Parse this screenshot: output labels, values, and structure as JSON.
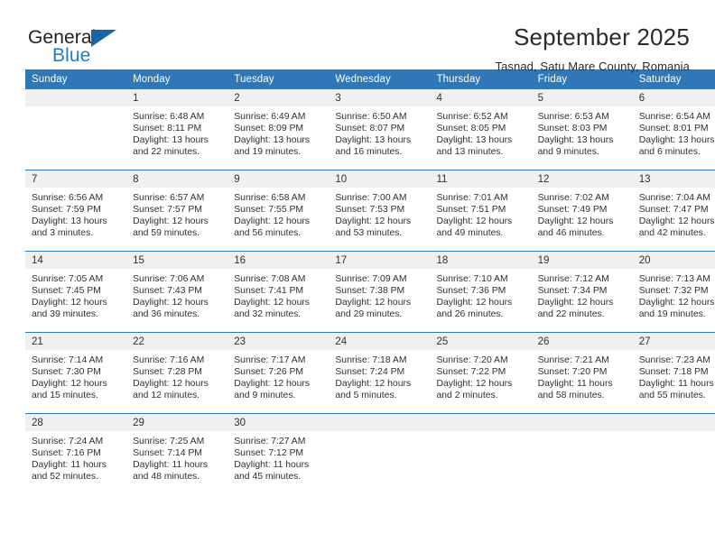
{
  "logo": {
    "word_top": "General",
    "word_bottom": "Blue",
    "triangle_color": "#1565a8",
    "blue_color": "#1f7cc4"
  },
  "header": {
    "title": "September 2025",
    "subtitle": "Tasnad, Satu Mare County, Romania"
  },
  "theme": {
    "header_blue": "#2f77b6",
    "daynum_gray": "#f0f0f0",
    "text": "#303030"
  },
  "calendar": {
    "weekday_headers": [
      "Sunday",
      "Monday",
      "Tuesday",
      "Wednesday",
      "Thursday",
      "Friday",
      "Saturday"
    ],
    "weeks": [
      [
        {
          "day": "",
          "sunrise": "",
          "sunset": "",
          "daylight_line1": "",
          "daylight_line2": ""
        },
        {
          "day": "1",
          "sunrise": "Sunrise: 6:48 AM",
          "sunset": "Sunset: 8:11 PM",
          "daylight_line1": "Daylight: 13 hours",
          "daylight_line2": "and 22 minutes."
        },
        {
          "day": "2",
          "sunrise": "Sunrise: 6:49 AM",
          "sunset": "Sunset: 8:09 PM",
          "daylight_line1": "Daylight: 13 hours",
          "daylight_line2": "and 19 minutes."
        },
        {
          "day": "3",
          "sunrise": "Sunrise: 6:50 AM",
          "sunset": "Sunset: 8:07 PM",
          "daylight_line1": "Daylight: 13 hours",
          "daylight_line2": "and 16 minutes."
        },
        {
          "day": "4",
          "sunrise": "Sunrise: 6:52 AM",
          "sunset": "Sunset: 8:05 PM",
          "daylight_line1": "Daylight: 13 hours",
          "daylight_line2": "and 13 minutes."
        },
        {
          "day": "5",
          "sunrise": "Sunrise: 6:53 AM",
          "sunset": "Sunset: 8:03 PM",
          "daylight_line1": "Daylight: 13 hours",
          "daylight_line2": "and 9 minutes."
        },
        {
          "day": "6",
          "sunrise": "Sunrise: 6:54 AM",
          "sunset": "Sunset: 8:01 PM",
          "daylight_line1": "Daylight: 13 hours",
          "daylight_line2": "and 6 minutes."
        }
      ],
      [
        {
          "day": "7",
          "sunrise": "Sunrise: 6:56 AM",
          "sunset": "Sunset: 7:59 PM",
          "daylight_line1": "Daylight: 13 hours",
          "daylight_line2": "and 3 minutes."
        },
        {
          "day": "8",
          "sunrise": "Sunrise: 6:57 AM",
          "sunset": "Sunset: 7:57 PM",
          "daylight_line1": "Daylight: 12 hours",
          "daylight_line2": "and 59 minutes."
        },
        {
          "day": "9",
          "sunrise": "Sunrise: 6:58 AM",
          "sunset": "Sunset: 7:55 PM",
          "daylight_line1": "Daylight: 12 hours",
          "daylight_line2": "and 56 minutes."
        },
        {
          "day": "10",
          "sunrise": "Sunrise: 7:00 AM",
          "sunset": "Sunset: 7:53 PM",
          "daylight_line1": "Daylight: 12 hours",
          "daylight_line2": "and 53 minutes."
        },
        {
          "day": "11",
          "sunrise": "Sunrise: 7:01 AM",
          "sunset": "Sunset: 7:51 PM",
          "daylight_line1": "Daylight: 12 hours",
          "daylight_line2": "and 49 minutes."
        },
        {
          "day": "12",
          "sunrise": "Sunrise: 7:02 AM",
          "sunset": "Sunset: 7:49 PM",
          "daylight_line1": "Daylight: 12 hours",
          "daylight_line2": "and 46 minutes."
        },
        {
          "day": "13",
          "sunrise": "Sunrise: 7:04 AM",
          "sunset": "Sunset: 7:47 PM",
          "daylight_line1": "Daylight: 12 hours",
          "daylight_line2": "and 42 minutes."
        }
      ],
      [
        {
          "day": "14",
          "sunrise": "Sunrise: 7:05 AM",
          "sunset": "Sunset: 7:45 PM",
          "daylight_line1": "Daylight: 12 hours",
          "daylight_line2": "and 39 minutes."
        },
        {
          "day": "15",
          "sunrise": "Sunrise: 7:06 AM",
          "sunset": "Sunset: 7:43 PM",
          "daylight_line1": "Daylight: 12 hours",
          "daylight_line2": "and 36 minutes."
        },
        {
          "day": "16",
          "sunrise": "Sunrise: 7:08 AM",
          "sunset": "Sunset: 7:41 PM",
          "daylight_line1": "Daylight: 12 hours",
          "daylight_line2": "and 32 minutes."
        },
        {
          "day": "17",
          "sunrise": "Sunrise: 7:09 AM",
          "sunset": "Sunset: 7:38 PM",
          "daylight_line1": "Daylight: 12 hours",
          "daylight_line2": "and 29 minutes."
        },
        {
          "day": "18",
          "sunrise": "Sunrise: 7:10 AM",
          "sunset": "Sunset: 7:36 PM",
          "daylight_line1": "Daylight: 12 hours",
          "daylight_line2": "and 26 minutes."
        },
        {
          "day": "19",
          "sunrise": "Sunrise: 7:12 AM",
          "sunset": "Sunset: 7:34 PM",
          "daylight_line1": "Daylight: 12 hours",
          "daylight_line2": "and 22 minutes."
        },
        {
          "day": "20",
          "sunrise": "Sunrise: 7:13 AM",
          "sunset": "Sunset: 7:32 PM",
          "daylight_line1": "Daylight: 12 hours",
          "daylight_line2": "and 19 minutes."
        }
      ],
      [
        {
          "day": "21",
          "sunrise": "Sunrise: 7:14 AM",
          "sunset": "Sunset: 7:30 PM",
          "daylight_line1": "Daylight: 12 hours",
          "daylight_line2": "and 15 minutes."
        },
        {
          "day": "22",
          "sunrise": "Sunrise: 7:16 AM",
          "sunset": "Sunset: 7:28 PM",
          "daylight_line1": "Daylight: 12 hours",
          "daylight_line2": "and 12 minutes."
        },
        {
          "day": "23",
          "sunrise": "Sunrise: 7:17 AM",
          "sunset": "Sunset: 7:26 PM",
          "daylight_line1": "Daylight: 12 hours",
          "daylight_line2": "and 9 minutes."
        },
        {
          "day": "24",
          "sunrise": "Sunrise: 7:18 AM",
          "sunset": "Sunset: 7:24 PM",
          "daylight_line1": "Daylight: 12 hours",
          "daylight_line2": "and 5 minutes."
        },
        {
          "day": "25",
          "sunrise": "Sunrise: 7:20 AM",
          "sunset": "Sunset: 7:22 PM",
          "daylight_line1": "Daylight: 12 hours",
          "daylight_line2": "and 2 minutes."
        },
        {
          "day": "26",
          "sunrise": "Sunrise: 7:21 AM",
          "sunset": "Sunset: 7:20 PM",
          "daylight_line1": "Daylight: 11 hours",
          "daylight_line2": "and 58 minutes."
        },
        {
          "day": "27",
          "sunrise": "Sunrise: 7:23 AM",
          "sunset": "Sunset: 7:18 PM",
          "daylight_line1": "Daylight: 11 hours",
          "daylight_line2": "and 55 minutes."
        }
      ],
      [
        {
          "day": "28",
          "sunrise": "Sunrise: 7:24 AM",
          "sunset": "Sunset: 7:16 PM",
          "daylight_line1": "Daylight: 11 hours",
          "daylight_line2": "and 52 minutes."
        },
        {
          "day": "29",
          "sunrise": "Sunrise: 7:25 AM",
          "sunset": "Sunset: 7:14 PM",
          "daylight_line1": "Daylight: 11 hours",
          "daylight_line2": "and 48 minutes."
        },
        {
          "day": "30",
          "sunrise": "Sunrise: 7:27 AM",
          "sunset": "Sunset: 7:12 PM",
          "daylight_line1": "Daylight: 11 hours",
          "daylight_line2": "and 45 minutes."
        },
        {
          "day": "",
          "sunrise": "",
          "sunset": "",
          "daylight_line1": "",
          "daylight_line2": ""
        },
        {
          "day": "",
          "sunrise": "",
          "sunset": "",
          "daylight_line1": "",
          "daylight_line2": ""
        },
        {
          "day": "",
          "sunrise": "",
          "sunset": "",
          "daylight_line1": "",
          "daylight_line2": ""
        },
        {
          "day": "",
          "sunrise": "",
          "sunset": "",
          "daylight_line1": "",
          "daylight_line2": ""
        }
      ]
    ]
  }
}
